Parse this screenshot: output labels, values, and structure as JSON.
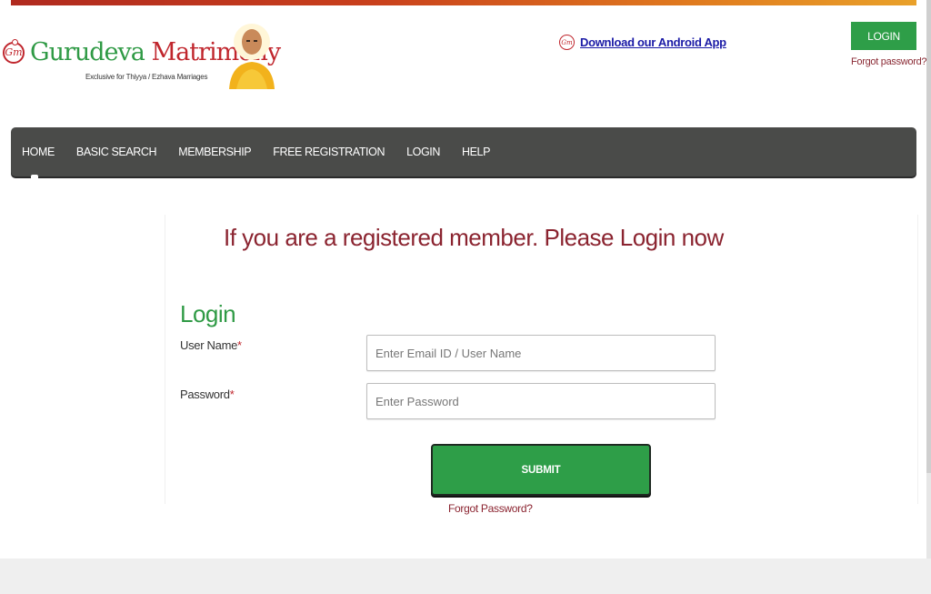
{
  "brand": {
    "logo_badge": "Gm",
    "name_part1": "Gurudeva",
    "name_part2": "Matrimony",
    "tagline": "Exclusive for Thiyya / Ezhava Marriages",
    "colors": {
      "green": "#2f9a45",
      "red": "#c0262d",
      "maroon": "#8b2430",
      "nav_bg": "#4a4b49"
    }
  },
  "header": {
    "android_link": "Download our Android App",
    "login_button": "LOGIN",
    "forgot_password": "Forgot password?"
  },
  "nav": {
    "items": [
      {
        "label": "HOME"
      },
      {
        "label": "BASIC SEARCH"
      },
      {
        "label": "MEMBERSHIP"
      },
      {
        "label": "FREE REGISTRATION"
      },
      {
        "label": "LOGIN"
      },
      {
        "label": "HELP"
      }
    ]
  },
  "main": {
    "headline": "If you are a registered member. Please Login now",
    "form_title": "Login",
    "username": {
      "label": "User Name",
      "required_mark": "*",
      "placeholder": "Enter Email ID / User Name",
      "value": ""
    },
    "password": {
      "label": "Password",
      "required_mark": "*",
      "placeholder": "Enter Password",
      "value": ""
    },
    "submit_label": "SUBMIT",
    "forgot_label": "Forgot Password?"
  }
}
